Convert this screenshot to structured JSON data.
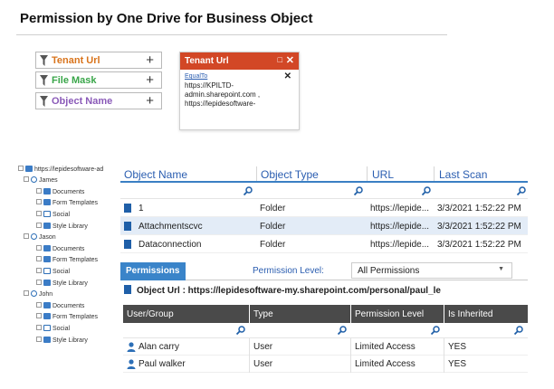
{
  "page": {
    "title": "Permission by One Drive for Business Object"
  },
  "filters": [
    {
      "label": "Tenant Url",
      "color": "#d9741c"
    },
    {
      "label": "File Mask",
      "color": "#3aa64a"
    },
    {
      "label": "Object Name",
      "color": "#8a5ab8"
    }
  ],
  "tenant_popup": {
    "title": "Tenant Url",
    "operator": "EqualTo",
    "values": [
      "https://KPILTD-",
      "admin.sharepoint.com ,",
      "https://lepidesoftware-"
    ]
  },
  "tree": {
    "root": "https://lepidesoftware-ad",
    "users": [
      {
        "name": "James",
        "items": [
          "Documents",
          "Form Templates",
          "Social",
          "Style Library"
        ]
      },
      {
        "name": "Jason",
        "items": [
          "Documents",
          "Form Templates",
          "Social",
          "Style Library"
        ]
      },
      {
        "name": "John",
        "items": [
          "Documents",
          "Form Templates",
          "Social",
          "Style Library"
        ]
      }
    ]
  },
  "object_grid": {
    "columns": [
      "Object Name",
      "Object Type",
      "URL",
      "Last Scan"
    ],
    "rows": [
      {
        "name": "1",
        "type": "Folder",
        "url": "https://lepide...",
        "scan": "3/3/2021 1:52:22 PM"
      },
      {
        "name": "Attachmentscvc",
        "type": "Folder",
        "url": "https://lepide...",
        "scan": "3/3/2021 1:52:22 PM"
      },
      {
        "name": "Dataconnection",
        "type": "Folder",
        "url": "https://lepide...",
        "scan": "3/3/2021 1:52:22 PM"
      }
    ]
  },
  "permissions": {
    "tab": "Permissions",
    "level_label": "Permission Level:",
    "level_value": "All Permissions",
    "object_url": "Object Url : https://lepidesoftware-my.sharepoint.com/personal/paul_le",
    "columns": [
      "User/Group",
      "Type",
      "Permission Level",
      "Is Inherited"
    ],
    "rows": [
      {
        "user": "Alan carry",
        "type": "User",
        "level": "Limited Access",
        "inherited": "YES"
      },
      {
        "user": "Paul walker",
        "type": "User",
        "level": "Limited Access",
        "inherited": "YES"
      }
    ]
  },
  "colors": {
    "accent_blue": "#3a84c9",
    "popup_red": "#d24726",
    "header_dark": "#4a4a4a"
  },
  "icons": [
    "funnel-icon",
    "plus-icon",
    "close-icon",
    "search-icon",
    "document-icon",
    "user-icon",
    "chevron-down-icon"
  ]
}
